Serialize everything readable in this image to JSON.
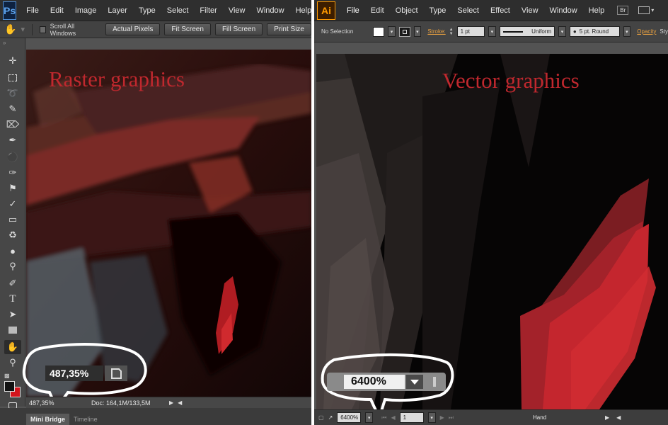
{
  "photoshop": {
    "logo": "Ps",
    "menu": [
      "File",
      "Edit",
      "Image",
      "Layer",
      "Type",
      "Select",
      "Filter",
      "View",
      "Window",
      "Help"
    ],
    "options": {
      "tool_icon": "hand-icon",
      "scroll_all_windows": "Scroll All Windows",
      "actual_pixels": "Actual Pixels",
      "fit_screen": "Fit Screen",
      "fill_screen": "Fill Screen",
      "print_size": "Print Size"
    },
    "canvas_title": "Raster graphics",
    "zoom_callout": "487,35%",
    "status": {
      "zoom": "487,35%",
      "doc": "Doc: 164,1M/133,5M"
    },
    "bottom_tabs": [
      "Mini Bridge",
      "Timeline"
    ]
  },
  "illustrator": {
    "logo": "Ai",
    "menu": [
      "File",
      "Edit",
      "Object",
      "Type",
      "Select",
      "Effect",
      "View",
      "Window",
      "Help"
    ],
    "bridge_button": "Br",
    "options": {
      "selection": "No Selection",
      "stroke_label": "Stroke:",
      "stroke_weight": "1 pt",
      "profile": "Uniform",
      "brush": "5 pt. Round",
      "opacity_label": "Opacity",
      "style_label": "Sty"
    },
    "canvas_title": "Vector graphics",
    "zoom_callout": "6400%",
    "status": {
      "zoom": "6400%",
      "artboard": "1",
      "tool": "Hand"
    }
  },
  "colors": {
    "title_red": "#c0282e",
    "ps_accent": "#5fa5ef",
    "ai_accent": "#ff9a00",
    "link_orange": "#e8a040"
  }
}
